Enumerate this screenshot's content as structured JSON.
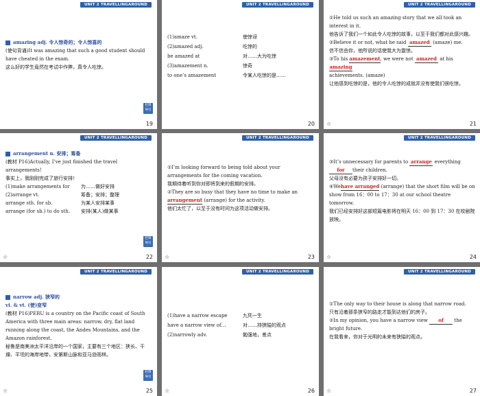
{
  "header_text": "UNIT 2 TRAVELLINGAROUND",
  "nav_tag": "栏目\n导引",
  "star": "☆",
  "slides": [
    {
      "num": "19",
      "lines": [
        {
          "t": "amazing  adj. 令人惊奇的；令人惊喜的"
        },
        {
          "t": "(使句背诵)It was amazing that such a good student should have cheated in the exam."
        },
        {
          "t": "这么好的学生竟然在考试中作弊，真令人吃惊。"
        }
      ]
    },
    {
      "num": "20",
      "rows": [
        {
          "l": "(1)amaze vt.",
          "r": "使惊讶"
        },
        {
          "l": "(2)amazed adj.",
          "r": "吃惊的"
        },
        {
          "l": "be amazed at",
          "r": "对……大为吃惊"
        },
        {
          "l": "(3)amazement n.",
          "r": "惊奇"
        },
        {
          "l": "to one’s amazement",
          "r": "令某人吃惊的是……"
        }
      ]
    },
    {
      "num": "21",
      "l1": "①He told us such an amazing story that we all took an interest in it.",
      "l2": "他告诉了我们一个如此令人吃惊的故事，以至于我们都对此感兴趣。",
      "l3a": "②Believe it or not, what he said",
      "b1": "amazed",
      "l3b": "(amaze) me.",
      "l4": "信不信由你，他所说的话使我大为震惊。",
      "l5a": "③To his",
      "b2": "amazement",
      "l5b": ", we were not",
      "b3": "amazed",
      "l5c": "at his",
      "b4": "amazing",
      "l6": "achievements. (amaze)",
      "l7": "让他感到吃惊的是，他的令人吃惊的成就并没有使我们很吃惊。"
    },
    {
      "num": "22",
      "title": "arrangement  n. 安排；筹备",
      "l1": "(教材 P16)Actually, I’ve just finished the travel arrangements!",
      "l2": "事实上，我刚刚完成了旅行安排！",
      "rows": [
        {
          "l": "(1)make arrangements for",
          "r": "为……做好安排"
        },
        {
          "l": "(2)arrange vt.",
          "r": "筹备；安排；整理"
        },
        {
          "l": "arrange sth. for sb.",
          "r": "为某人安排某事"
        },
        {
          "l": "arrange (for sb.) to do sth.",
          "r": "安排(某人)做某事"
        }
      ]
    },
    {
      "num": "23",
      "l1": "①I’m looking forward to being told about your arrangements for the coming vacation.",
      "l2": "我期待着听到你对即将到来的假期的安排。",
      "l3a": "②They are so busy that they have no time to make an",
      "b1": "arrangement",
      "l3b": "(arrange) for the activity.",
      "l4": "他们太忙了，以至于没有时间为这项活动做安排。"
    },
    {
      "num": "24",
      "l1a": "③It’s unnecessary for parents to",
      "b1": "arrange",
      "l1b": "everything",
      "b2": "for",
      "l1c": "their children.",
      "l2": "父母没有必要为孩子安排好一切。",
      "l3a": "④We",
      "b3": "have arranged",
      "l3b": "(arrange) that the short film will be on show from 16：00 to 17：30 at our school theatre tomorrow.",
      "l4": "我们已经安排好这部短篇电影将在明天 16：00 到 17：30 在校剧院放映。"
    },
    {
      "num": "25",
      "title": "narrow  adj. 狭窄的",
      "title2": "vi. & vt. (使)变窄",
      "l1": "(教材 P16)PERU is a country on the Pacific coast of South America with three main areas: narrow, dry, flat land running along the coast, the Andes Mountains, and the Amazon rainforest.",
      "l2": "秘鲁是南美洲太平洋沿岸的一个国家，主要有三个地区：狭长、干燥、平坦的海岸地带，安第斯山脉和亚马逊雨林。"
    },
    {
      "num": "26",
      "rows": [
        {
          "l": "(1)have a narrow escape",
          "r": "九死一生"
        },
        {
          "l": "have a narrow view of…",
          "r": "对……持狭隘的观点"
        },
        {
          "l": "(2)narrowly adv.",
          "r": "勉强地，差点"
        }
      ]
    },
    {
      "num": "27",
      "l1": "①The only way to their house is along that narrow road.",
      "l2": "只有沿着那条狭窄的路走才能到达他们的房子。",
      "l3a": "②In my opinion, you have a narrow view",
      "b1": "of",
      "l3b": "the bright future.",
      "l4": "在我看来，你对于光明的未来有狭隘的观点。"
    }
  ]
}
